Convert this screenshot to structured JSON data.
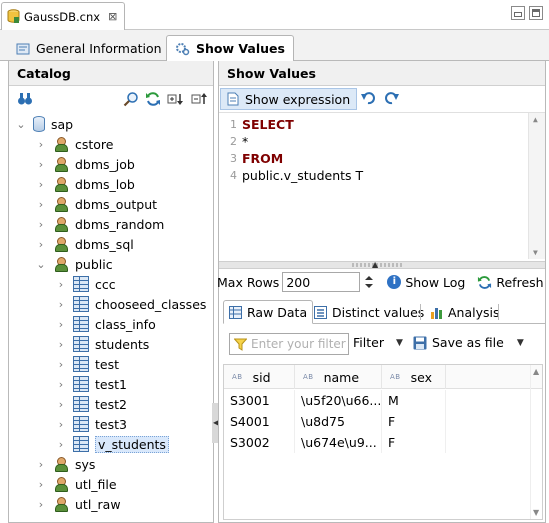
{
  "editor_tab": {
    "title": "GaussDB.cnx",
    "close": "⊠"
  },
  "view_tabs": [
    {
      "label": "General Information",
      "active": false
    },
    {
      "label": "Show Values",
      "active": true
    }
  ],
  "catalog": {
    "title": "Catalog",
    "tree": {
      "root": "sap",
      "schemas_before": [
        "cstore",
        "dbms_job",
        "dbms_lob",
        "dbms_output",
        "dbms_random",
        "dbms_sql"
      ],
      "open_schema": "public",
      "tables": [
        "ccc",
        "chooseed_classes",
        "class_info",
        "students",
        "test",
        "test1",
        "test2",
        "test3"
      ],
      "selected_view": "v_students",
      "schemas_after": [
        "sys",
        "utl_file",
        "utl_raw"
      ]
    }
  },
  "show_values": {
    "title": "Show Values",
    "show_expression_label": "Show expression",
    "sql": {
      "line_numbers": [
        "1",
        "2",
        "3",
        "4"
      ],
      "lines": [
        "SELECT",
        "*",
        "FROM",
        "public.v_students T"
      ]
    },
    "max_rows_label": "Max Rows",
    "max_rows_value": "200",
    "show_log_label": "Show Log",
    "refresh_label": "Refresh",
    "result_tabs": [
      {
        "label": "Raw Data",
        "active": true
      },
      {
        "label": "Distinct values",
        "active": false
      },
      {
        "label": "Analysis",
        "active": false
      }
    ],
    "filter_placeholder": "Enter your filter",
    "filter_label": "Filter",
    "save_label": "Save as file",
    "grid": {
      "type_badge": "AB",
      "columns": [
        "sid",
        "name",
        "sex"
      ],
      "rows": [
        [
          "S3001",
          "\\u5f20\\u66...",
          "M"
        ],
        [
          "S4001",
          "\\u8d75",
          "F"
        ],
        [
          "S3002",
          "\\u674e\\u9...",
          "F"
        ]
      ]
    }
  }
}
